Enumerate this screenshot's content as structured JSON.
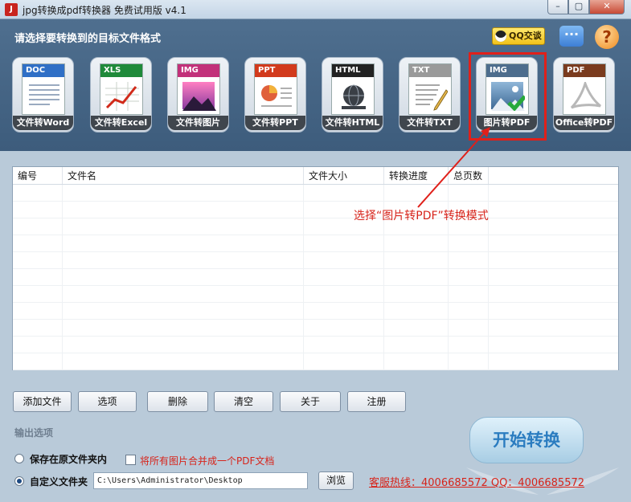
{
  "window": {
    "title": "jpg转换成pdf转换器 免费试用版 v4.1",
    "controls": {
      "minimize": "–",
      "maximize": "▢",
      "close": "✕"
    }
  },
  "header": {
    "prompt": "请选择要转换到的目标文件格式",
    "qq_label": "QQ交谈",
    "chat_icon": "···",
    "help_icon": "?"
  },
  "tools": [
    {
      "badge": "DOC",
      "label": "文件转Word",
      "color": "#2f6fc6"
    },
    {
      "badge": "XLS",
      "label": "文件转Excel",
      "color": "#1f8a3a"
    },
    {
      "badge": "IMG",
      "label": "文件转图片",
      "color": "#c2317a"
    },
    {
      "badge": "PPT",
      "label": "文件转PPT",
      "color": "#d23a1c"
    },
    {
      "badge": "HTML",
      "label": "文件转HTML",
      "color": "#222222"
    },
    {
      "badge": "TXT",
      "label": "文件转TXT",
      "color": "#8a8a8a"
    },
    {
      "badge": "IMG",
      "label": "图片转PDF",
      "color": "#4d6d8d"
    },
    {
      "badge": "PDF",
      "label": "Office转PDF",
      "color": "#7a3b1e"
    }
  ],
  "table": {
    "columns": [
      "编号",
      "文件名",
      "文件大小",
      "转换进度",
      "总页数"
    ]
  },
  "annotation": "选择“图片转PDF”转换模式",
  "buttons": {
    "add": "添加文件",
    "options": "选项",
    "delete": "删除",
    "clear": "清空",
    "about": "关于",
    "register": "注册"
  },
  "output": {
    "section_label": "输出选项",
    "save_in_source": "保存在原文件夹内",
    "merge_all": "将所有图片合并成一个PDF文档",
    "custom_folder": "自定义文件夹",
    "path": "C:\\Users\\Administrator\\Desktop",
    "browse": "浏览"
  },
  "start_button": "开始转换",
  "hotline": "客服热线：4006685572 QQ：4006685572"
}
